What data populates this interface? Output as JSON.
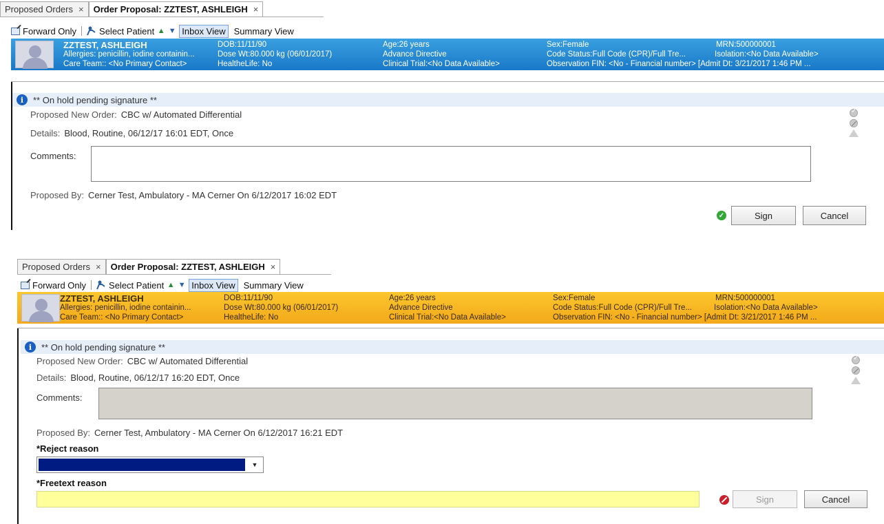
{
  "tabs": {
    "proposed_orders": "Proposed Orders",
    "order_proposal": "Order Proposal: ZZTEST, ASHLEIGH",
    "close": "×"
  },
  "toolbar": {
    "forward_only": "Forward Only",
    "select_patient": "Select Patient",
    "inbox_view": "Inbox View",
    "summary_view": "Summary View"
  },
  "patient": {
    "name": "ZZTEST, ASHLEIGH",
    "allergies": "Allergies: penicillin, iodine containin...",
    "care_team": "Care Team:: <No Primary Contact>",
    "dob": "DOB:11/11/90",
    "dose_wt": "Dose Wt:80.000 kg (06/01/2017)",
    "healthelife": "HealtheLife: No",
    "age": "Age:26 years",
    "advance_directive": "Advance Directive",
    "clinical_trial": "Clinical Trial:<No Data Available>",
    "sex": "Sex:Female",
    "code_status": "Code Status:Full Code (CPR)/Full Tre...",
    "observation_fin": "Observation FIN: <No -  Financial number> [Admit Dt: 3/21/2017 1:46 PM ...",
    "mrn": "MRN:500000001",
    "isolation": "Isolation:<No Data Available>"
  },
  "panel_top": {
    "hold_text": "** On hold pending signature **",
    "proposed_label": "Proposed New Order:",
    "proposed_value": "CBC w/ Automated Differential",
    "details_label": "Details:",
    "details_value": "Blood, Routine, 06/12/17 16:01 EDT, Once",
    "comments_label": "Comments:",
    "proposed_by_label": "Proposed By:",
    "proposed_by_value": "Cerner Test, Ambulatory - MA Cerner On 6/12/2017 16:02 EDT",
    "sign": "Sign",
    "cancel": "Cancel"
  },
  "panel_bottom": {
    "hold_text": "** On hold pending signature **",
    "proposed_label": "Proposed New Order:",
    "proposed_value": "CBC w/ Automated Differential",
    "details_label": "Details:",
    "details_value": "Blood, Routine, 06/12/17 16:20 EDT, Once",
    "comments_label": "Comments:",
    "proposed_by_label": "Proposed By:",
    "proposed_by_value": "Cerner Test, Ambulatory - MA Cerner On 6/12/2017 16:21 EDT",
    "reject_reason_label": "*Reject reason",
    "reject_reason_value": "",
    "freetext_reason_label": "*Freetext reason",
    "freetext_reason_value": "",
    "sign": "Sign",
    "cancel": "Cancel"
  },
  "colors": {
    "banner_top": "#1978c8",
    "banner_bottom": "#f4a91a",
    "freetext_bg": "#ffff9c",
    "reject_select": "#001c82",
    "hold_bar": "#e6eefa"
  },
  "icons": [
    "forward-icon",
    "person-icon",
    "arrow-up-icon",
    "arrow-down-icon",
    "info-icon",
    "check-icon",
    "cancel-icon"
  ]
}
